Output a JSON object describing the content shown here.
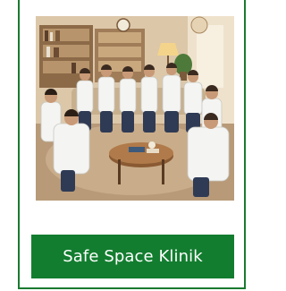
{
  "card": {
    "image_alt": "Group of people in white coats sitting in a circle in a cozy room",
    "button_label": "Safe Space Klinik"
  },
  "colors": {
    "accent": "#127d2f",
    "border": "#1a7a30"
  }
}
